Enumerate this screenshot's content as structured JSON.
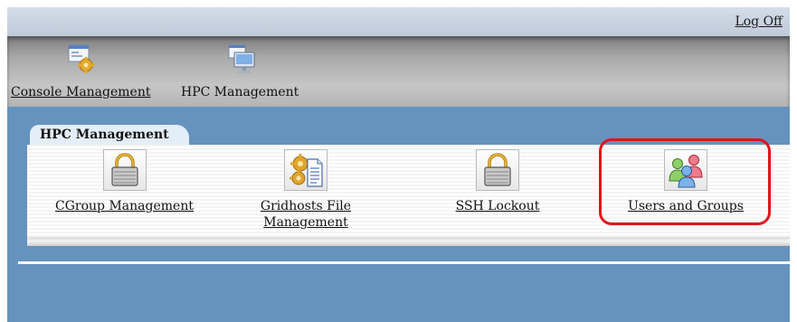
{
  "header": {
    "logoff_label": "Log Off"
  },
  "nav": {
    "items": [
      {
        "label": "Console Management",
        "icon": "console-management-icon"
      },
      {
        "label": "HPC Management",
        "icon": "hpc-management-icon"
      }
    ]
  },
  "panel": {
    "tab_label": "HPC Management",
    "apps": [
      {
        "label": "CGroup Management",
        "icon": "padlock-icon"
      },
      {
        "label_line1": "Gridhosts File",
        "label_line2": "Management",
        "icon": "gears-document-icon"
      },
      {
        "label": "SSH Lockout",
        "icon": "padlock-icon"
      },
      {
        "label": "Users and Groups",
        "icon": "users-groups-icon"
      }
    ]
  },
  "colors": {
    "background": "#6593bd",
    "highlight": "#e0141b"
  }
}
